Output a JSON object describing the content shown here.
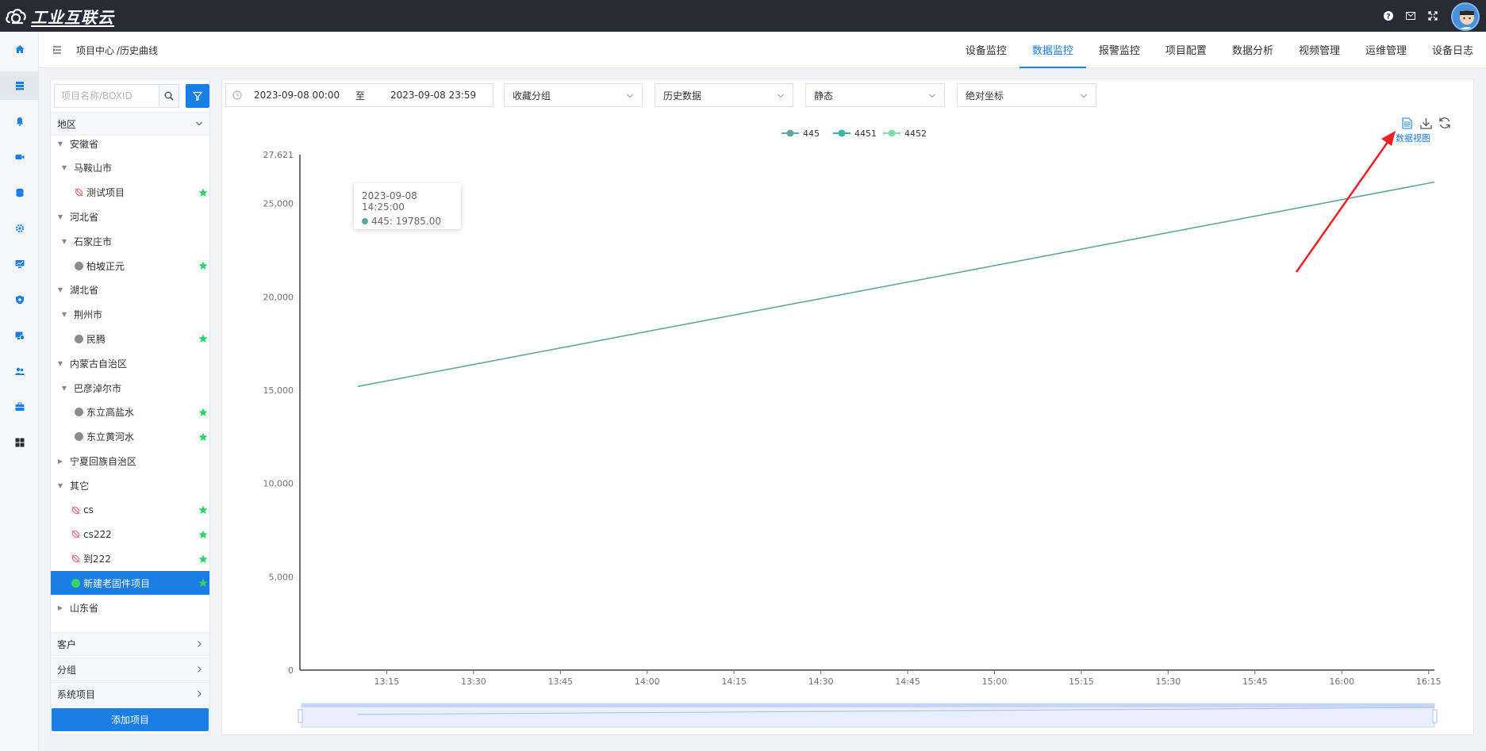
{
  "app": {
    "logo_text": "工业互联云"
  },
  "header": {
    "breadcrumb": [
      "项目中心",
      "/历史曲线"
    ],
    "tabs": [
      {
        "label": "设备监控",
        "active": false
      },
      {
        "label": "数据监控",
        "active": true
      },
      {
        "label": "报警监控",
        "active": false
      },
      {
        "label": "项目配置",
        "active": false
      },
      {
        "label": "数据分析",
        "active": false
      },
      {
        "label": "视频管理",
        "active": false
      },
      {
        "label": "运维管理",
        "active": false
      },
      {
        "label": "设备日志",
        "active": false
      }
    ]
  },
  "sidebar": {
    "search_placeholder": "项目名称/BOXID",
    "groups": {
      "region": "地区",
      "customer": "客户",
      "group": "分组",
      "system": "系统项目"
    },
    "tree": [
      {
        "label": "安徽省",
        "level": 0,
        "caret": "down"
      },
      {
        "label": "马鞍山市",
        "level": 1,
        "caret": "down"
      },
      {
        "label": "测试项目",
        "level": 2,
        "icon": "link",
        "star": true
      },
      {
        "label": "河北省",
        "level": 0,
        "caret": "down"
      },
      {
        "label": "石家庄市",
        "level": 1,
        "caret": "down"
      },
      {
        "label": "柏坡正元",
        "level": 2,
        "icon": "gray",
        "star": true
      },
      {
        "label": "湖北省",
        "level": 0,
        "caret": "down"
      },
      {
        "label": "荆州市",
        "level": 1,
        "caret": "down"
      },
      {
        "label": "民腾",
        "level": 2,
        "icon": "gray",
        "star": true
      },
      {
        "label": "内蒙古自治区",
        "level": 0,
        "caret": "down"
      },
      {
        "label": "巴彦淖尔市",
        "level": 1,
        "caret": "down"
      },
      {
        "label": "东立高盐水",
        "level": 2,
        "icon": "gray",
        "star": true
      },
      {
        "label": "东立黄河水",
        "level": 2,
        "icon": "gray",
        "star": true
      },
      {
        "label": "宁夏回族自治区",
        "level": 0,
        "caret": "right"
      },
      {
        "label": "其它",
        "level": 0,
        "caret": "down"
      },
      {
        "label": "cs",
        "level": 1,
        "icon": "link",
        "star": true
      },
      {
        "label": "cs222",
        "level": 1,
        "icon": "link",
        "star": true
      },
      {
        "label": "到222",
        "level": 1,
        "icon": "link",
        "star": true
      },
      {
        "label": "新建老固件项目",
        "level": 1,
        "icon": "green",
        "star": true,
        "selected": true
      },
      {
        "label": "山东省",
        "level": 0,
        "caret": "right"
      }
    ],
    "add_button": "添加项目"
  },
  "filters": {
    "date_start": "2023-09-08 00:00",
    "date_sep": "至",
    "date_end": "2023-09-08 23:59",
    "favorite_group": "收藏分组",
    "data_type": "历史数据",
    "mode": "静态",
    "coord": "绝对坐标"
  },
  "toolbox": {
    "data_view_label": "数据视图"
  },
  "tooltip": {
    "time": "2023-09-08 14:25:00",
    "series_label": "445: 19785.00"
  },
  "colors": {
    "accent": "#1a7ee6",
    "series1": "#5fa89a",
    "series2": "#36b7a4",
    "series3": "#84d9b0"
  },
  "chart_data": {
    "type": "line",
    "legend": [
      "445",
      "4451",
      "4452"
    ],
    "x_tick_labels": [
      "13:15",
      "13:30",
      "13:45",
      "14:00",
      "14:15",
      "14:30",
      "14:45",
      "15:00",
      "15:15",
      "15:30",
      "15:45",
      "16:00",
      "16:15"
    ],
    "y_tick_labels": [
      "0",
      "5,000",
      "10,000",
      "15,000",
      "20,000",
      "25,000",
      "27,621"
    ],
    "y_ticks": [
      0,
      5000,
      10000,
      15000,
      20000,
      25000,
      27621
    ],
    "ylim": [
      0,
      27621
    ],
    "x_range_minutes": [
      780,
      976
    ],
    "series": [
      {
        "name": "445",
        "points": [
          {
            "x": "13:10",
            "y": 15200
          },
          {
            "x": "16:16",
            "y": 26150
          }
        ]
      }
    ]
  }
}
